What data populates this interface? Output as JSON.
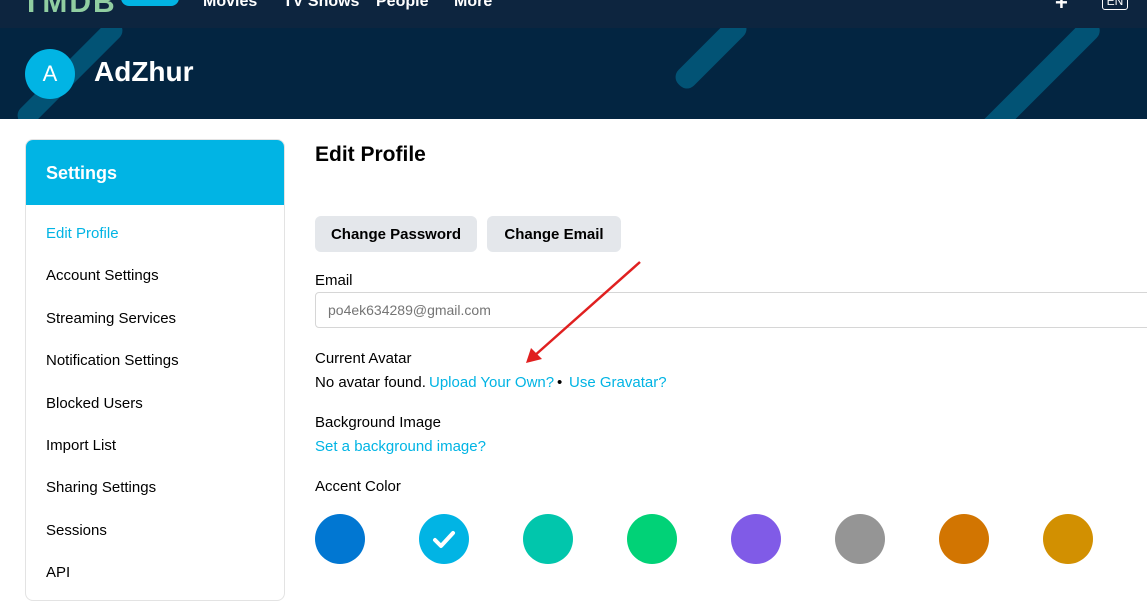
{
  "topnav": {
    "logo": "TMDB",
    "items": [
      "Movies",
      "TV Shows",
      "People",
      "More"
    ],
    "add_icon": "plus-icon",
    "lang": "EN"
  },
  "header": {
    "avatar_letter": "A",
    "username": "AdZhur"
  },
  "sidebar": {
    "title": "Settings",
    "items": [
      {
        "label": "Edit Profile",
        "active": true
      },
      {
        "label": "Account Settings"
      },
      {
        "label": "Streaming Services"
      },
      {
        "label": "Notification Settings"
      },
      {
        "label": "Blocked Users"
      },
      {
        "label": "Import List"
      },
      {
        "label": "Sharing Settings"
      },
      {
        "label": "Sessions"
      },
      {
        "label": "API"
      }
    ]
  },
  "main": {
    "title": "Edit Profile",
    "buttons": {
      "change_password": "Change Password",
      "change_email": "Change Email"
    },
    "email": {
      "label": "Email",
      "placeholder": "po4ek634289@gmail.com"
    },
    "avatar": {
      "label": "Current Avatar",
      "status": "No avatar found.",
      "upload_link": "Upload Your Own?",
      "separator": "•",
      "gravatar_link": "Use Gravatar?"
    },
    "background": {
      "label": "Background Image",
      "link": "Set a background image?"
    },
    "accent": {
      "label": "Accent Color",
      "colors": [
        "#0177d2",
        "#01b4e4",
        "#01c6ac",
        "#01d277",
        "#805be7",
        "#959595",
        "#d27501",
        "#d29001"
      ],
      "selected_index": 1
    }
  },
  "annotation": {
    "arrow_color": "#e02020"
  }
}
